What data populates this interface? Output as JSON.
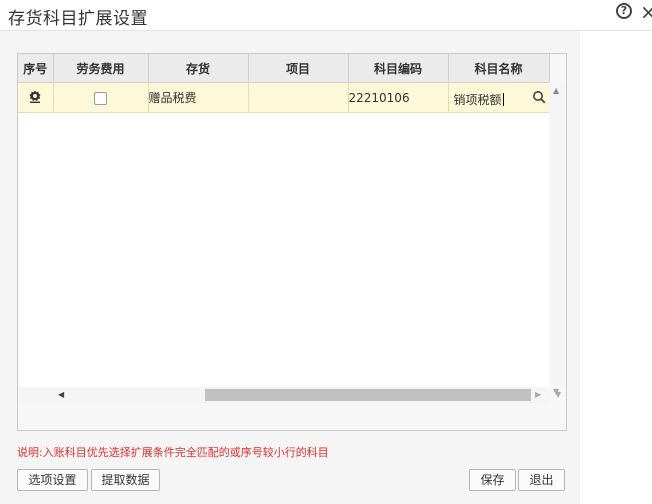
{
  "window": {
    "title": "存货科目扩展设置"
  },
  "grid": {
    "columns": [
      "序号",
      "劳务费用",
      "存货",
      "项目",
      "科目编码",
      "科目名称"
    ],
    "rows": [
      {
        "service_fee_checked": false,
        "inventory": "赠品税费",
        "project": "",
        "account_code": "22210106",
        "account_name": "销项税额"
      }
    ]
  },
  "note": "说明:入账科目优先选择扩展条件完全匹配的或序号较小行的科目",
  "buttons": {
    "options": "选项设置",
    "fetch": "提取数据",
    "save": "保存",
    "exit": "退出"
  }
}
